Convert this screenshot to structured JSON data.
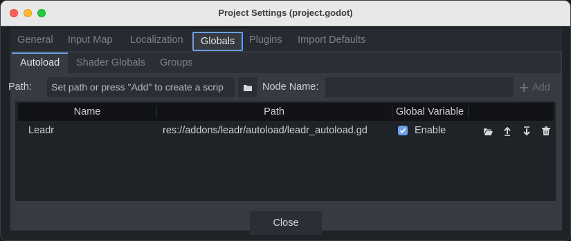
{
  "window": {
    "title": "Project Settings (project.godot)"
  },
  "top_tabs": [
    "General",
    "Input Map",
    "Localization",
    "Globals",
    "Plugins",
    "Import Defaults"
  ],
  "active_top_tab": "Globals",
  "sub_tabs": [
    "Autoload",
    "Shader Globals",
    "Groups"
  ],
  "active_sub_tab": "Autoload",
  "form": {
    "path_label": "Path:",
    "path_value": "Set path or press \"Add\" to create a scrip",
    "node_name_label": "Node Name:",
    "node_name_value": "",
    "add_label": "Add"
  },
  "table": {
    "headers": {
      "name": "Name",
      "path": "Path",
      "global": "Global Variable"
    },
    "rows": [
      {
        "name": "Leadr",
        "path": "res://addons/leadr/autoload/leadr_autoload.gd",
        "enable_label": "Enable",
        "enabled": true
      }
    ]
  },
  "footer": {
    "close_label": "Close"
  },
  "colors": {
    "accent": "#6aa0e6",
    "background": "#1f2227",
    "panel": "#363a41",
    "header": "#111317"
  },
  "icons": [
    "folder-icon",
    "plus-icon",
    "checkmark-icon",
    "folder-open-icon",
    "move-up-icon",
    "move-down-icon",
    "trash-icon"
  ]
}
